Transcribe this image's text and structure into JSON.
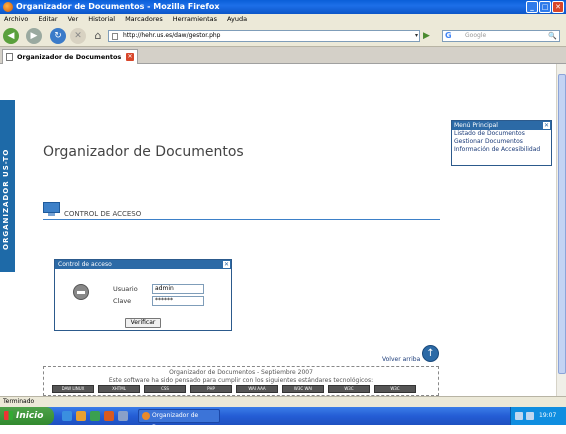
{
  "window": {
    "title": "Organizador de Documentos - Mozilla Firefox",
    "min": "_",
    "max": "□",
    "close": "✕"
  },
  "menubar": [
    "Archivo",
    "Editar",
    "Ver",
    "Historial",
    "Marcadores",
    "Herramientas",
    "Ayuda"
  ],
  "nav": {
    "url": "http://hehr.us.es/daw/gestor.php",
    "search_placeholder": "Google",
    "go": "▶",
    "url_dropdown": "▾",
    "search_g": "G",
    "search_mag": "🔍",
    "back": "◀",
    "forward": "▶",
    "reload": "↻",
    "stop": "✕",
    "home": "⌂"
  },
  "tab": {
    "label": "Organizador de Documentos",
    "close": "✕"
  },
  "page": {
    "side_label": "ORGANIZADOR US-TO",
    "title": "Organizador de Documentos",
    "section_title": "CONTROL DE ACCESO",
    "menu_principal": {
      "title": "Menú Principal",
      "close": "✕",
      "items": [
        "Listado de Documentos",
        "Gestionar Documentos",
        "Información de Accesibilidad"
      ]
    },
    "login": {
      "title": "Control de acceso",
      "close": "✕",
      "user_label": "Usuario",
      "user_value": "admin",
      "pass_label": "Clave",
      "pass_value": "******",
      "submit": "Verificar"
    },
    "volver": "Volver arriba",
    "up_arrow": "↑",
    "footer": {
      "line1": "Organizador de Documentos - Septiembre 2007",
      "line2": "Este software ha sido pensado para cumplir con los siguientes estándares tecnológicos:",
      "badges": [
        "DAW LINUX",
        "XHTML",
        "CSS",
        "PHP",
        "WAI AAA",
        "W3C WAI",
        "W3C",
        "W3C"
      ]
    }
  },
  "status": "Terminado",
  "taskbar": {
    "start": "Inicio",
    "item": "Organizador de Docu...",
    "clock": "19:07"
  }
}
